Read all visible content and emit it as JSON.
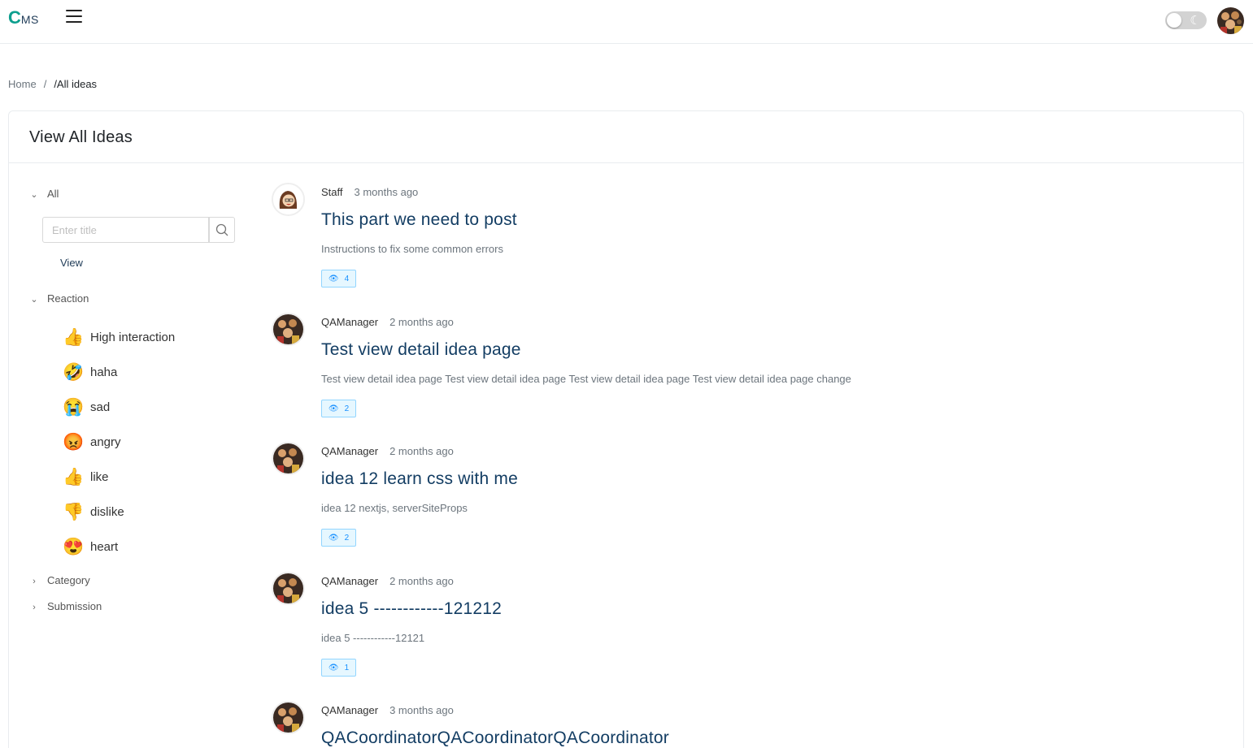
{
  "header": {
    "logo_c": "C",
    "logo_ms": "MS",
    "menu_icon": "hamburger-icon",
    "theme_icon": "moon-icon",
    "avatar_icon": "user-avatar"
  },
  "breadcrumb": {
    "home": "Home",
    "separator": "/",
    "current": "/All ideas"
  },
  "card": {
    "title": "View All Ideas"
  },
  "filters": {
    "all_label": "All",
    "search": {
      "placeholder": "Enter title",
      "value": ""
    },
    "view_label": "View",
    "reaction_label": "Reaction",
    "reactions": [
      {
        "label": "High interaction",
        "emoji": "👍"
      },
      {
        "label": "haha",
        "emoji": "🤣"
      },
      {
        "label": "sad",
        "emoji": "😭"
      },
      {
        "label": "angry",
        "emoji": "😡"
      },
      {
        "label": "like",
        "emoji": "👍"
      },
      {
        "label": "dislike",
        "emoji": "👎"
      },
      {
        "label": "heart",
        "emoji": "😍"
      }
    ],
    "category_label": "Category",
    "submission_label": "Submission"
  },
  "ideas": [
    {
      "author": "Staff",
      "time": "3 months ago",
      "title": "This part we need to post",
      "description": "Instructions to fix some common errors",
      "views": "4"
    },
    {
      "author": "QAManager",
      "time": "2 months ago",
      "title": "Test view detail idea page",
      "description": "Test view detail idea page Test view detail idea page Test view detail idea page Test view detail idea page change",
      "views": "2"
    },
    {
      "author": "QAManager",
      "time": "2 months ago",
      "title": "idea 12 learn css with me",
      "description": "idea 12 nextjs, serverSiteProps",
      "views": "2"
    },
    {
      "author": "QAManager",
      "time": "2 months ago",
      "title": "idea 5 ------------121212",
      "description": "idea 5 ------------12121",
      "views": "1"
    },
    {
      "author": "QAManager",
      "time": "3 months ago",
      "title": "QACoordinatorQACoordinatorQACoordinator",
      "description": "",
      "views": ""
    }
  ]
}
